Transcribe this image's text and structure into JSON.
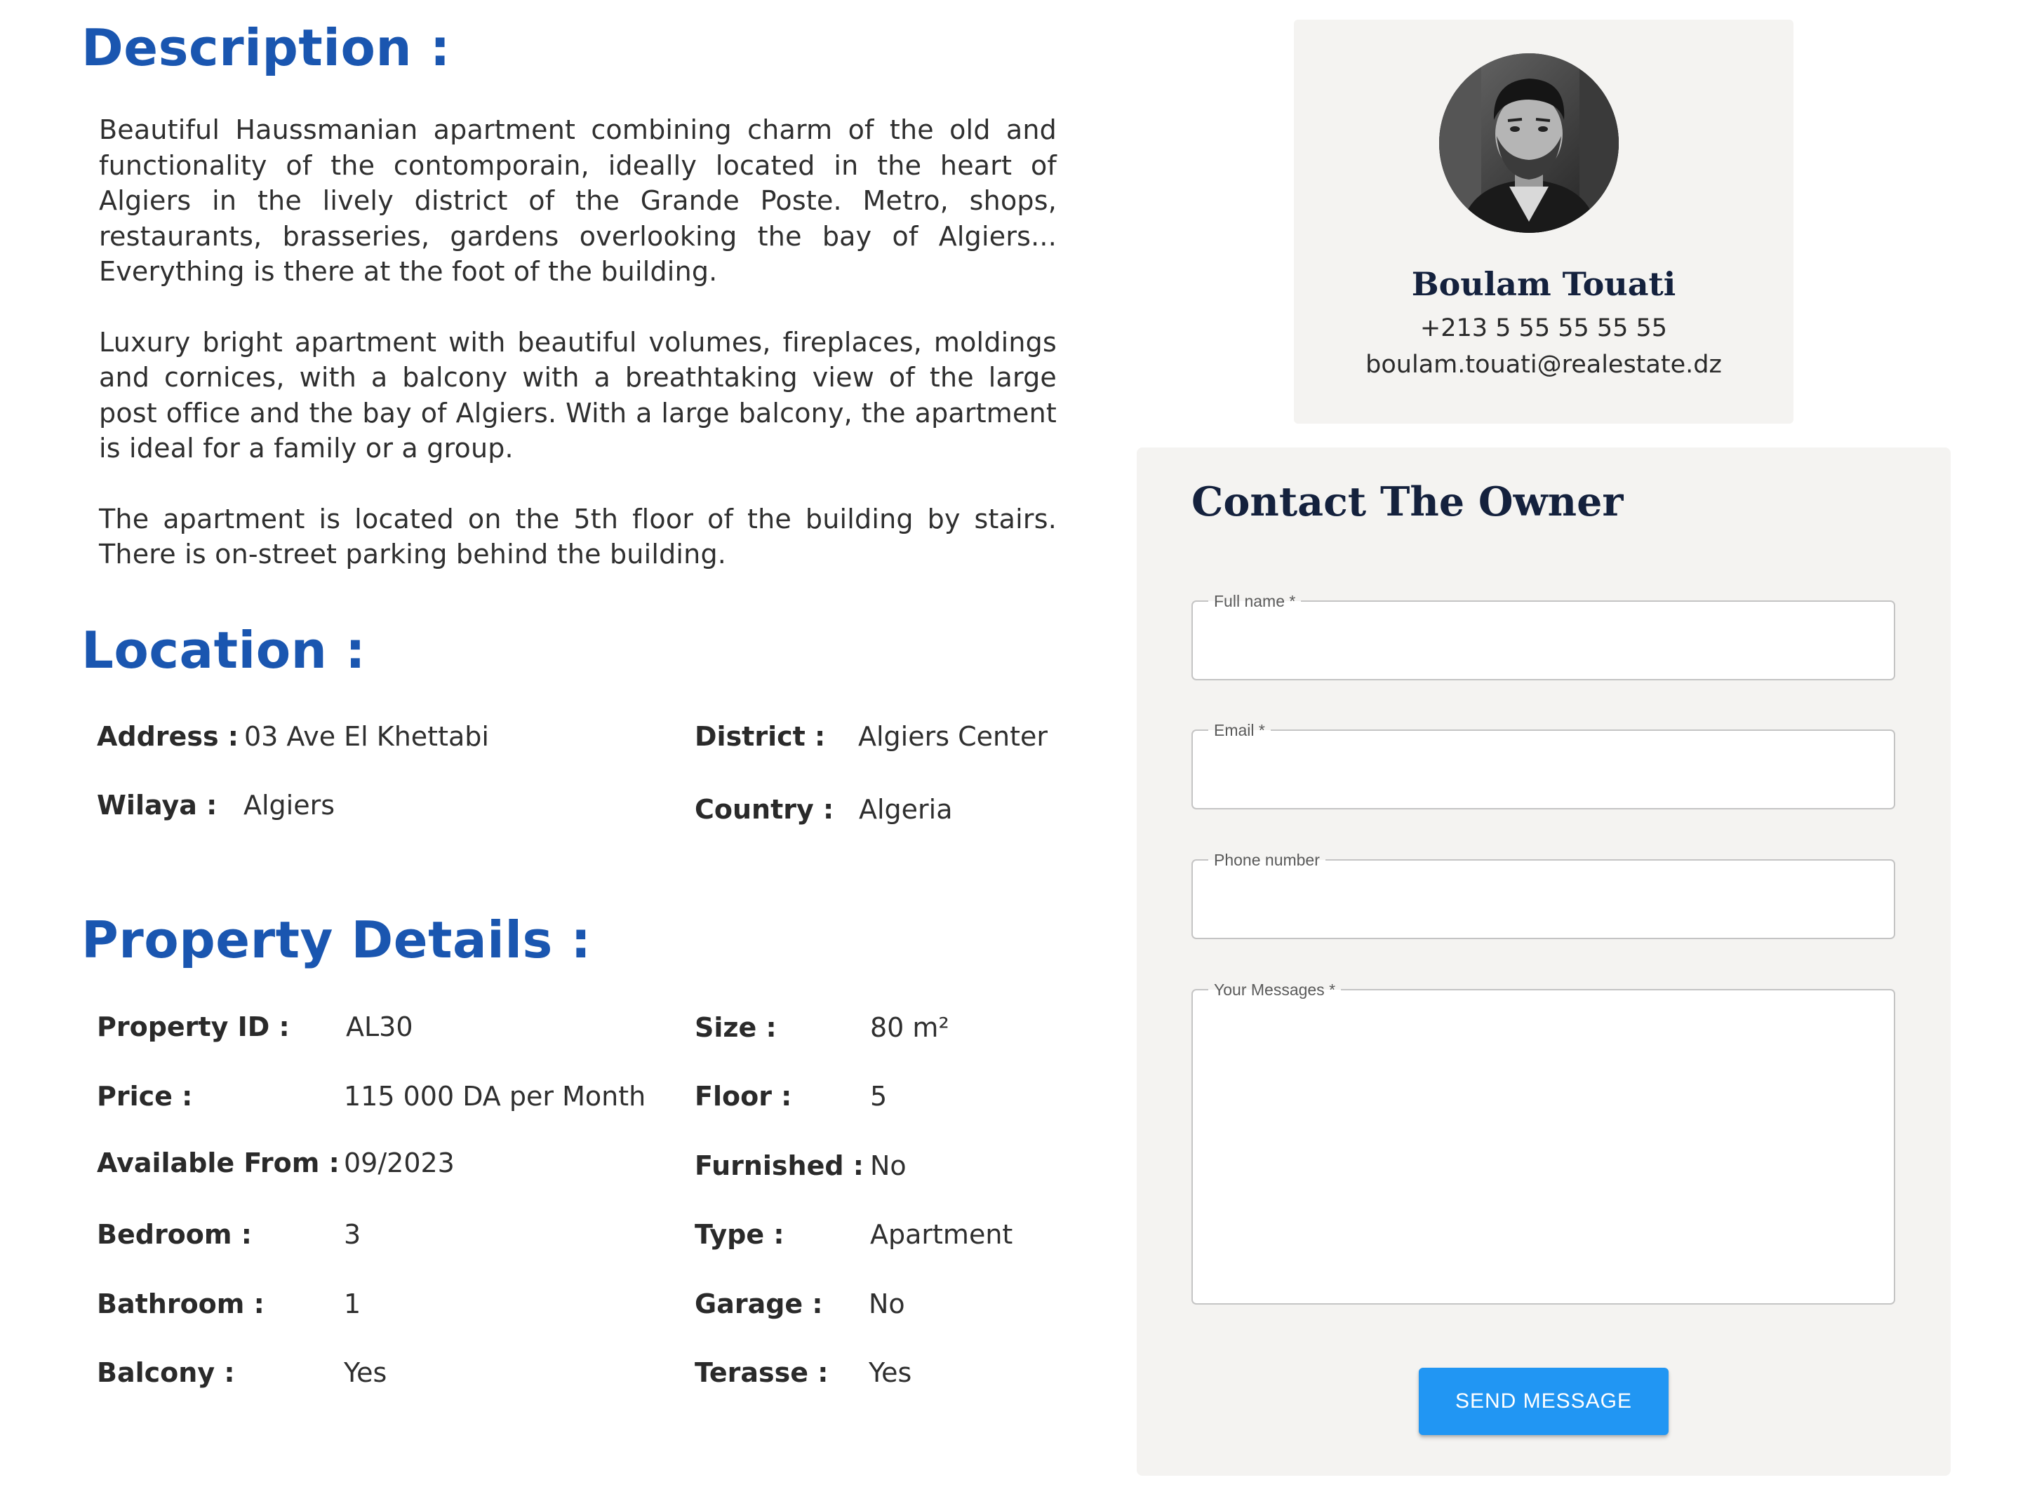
{
  "description": {
    "title": "Description :",
    "paragraphs": [
      "Beautiful Haussmanian apartment combining charm of the old and functionality of the contomporain, ideally located in the heart of Algiers in the lively district of the Grande Poste. Metro, shops, restaurants, brasseries, gardens overlooking the bay of Algiers... Everything is there at the foot of the building.",
      "Luxury bright apartment with beautiful volumes, fireplaces, moldings and cornices, with a balcony with a breathtaking view of the large post office and the bay of Algiers. With a large balcony, the apartment is ideal for a family or a group.",
      "The apartment is located on the 5th floor of the building by stairs. There is on-street parking behind the building."
    ]
  },
  "location": {
    "title": "Location :",
    "address_label": "Address :",
    "address_value": "03 Ave El Khettabi",
    "district_label": "District :",
    "district_value": "Algiers Center",
    "wilaya_label": "Wilaya :",
    "wilaya_value": "Algiers",
    "country_label": "Country :",
    "country_value": "Algeria"
  },
  "details": {
    "title": "Property Details :",
    "items": [
      {
        "label": "Property ID :",
        "value": "AL30"
      },
      {
        "label": "Size :",
        "value": "80 m²"
      },
      {
        "label": "Price :",
        "value": "115 000 DA per Month"
      },
      {
        "label": "Floor :",
        "value": "5"
      },
      {
        "label": "Available From  :",
        "value": "09/2023"
      },
      {
        "label": "Furnished :",
        "value": "No"
      },
      {
        "label": "Bedroom :",
        "value": "3"
      },
      {
        "label": "Type :",
        "value": "Apartment"
      },
      {
        "label": "Bathroom :",
        "value": "1"
      },
      {
        "label": "Garage :",
        "value": "No"
      },
      {
        "label": "Balcony :",
        "value": "Yes"
      },
      {
        "label": "Terasse :",
        "value": "Yes"
      }
    ]
  },
  "agent": {
    "name": "Boulam Touati",
    "phone": "+213 5 55 55 55 55",
    "email": "boulam.touati@realestate.dz",
    "avatar_icon": "user-avatar-photo"
  },
  "contact": {
    "title": "Contact The Owner",
    "full_name_label": "Full name *",
    "full_name_value": "",
    "email_label": "Email *",
    "email_value": "",
    "phone_label": "Phone number",
    "phone_value": "",
    "message_label": "Your Messages *",
    "message_value": "",
    "send_label": "SEND MESSAGE"
  },
  "colors": {
    "heading_blue": "#1a56b0",
    "card_bg": "#f4f3f1",
    "button_blue": "#2196f3",
    "navy": "#14213d"
  }
}
